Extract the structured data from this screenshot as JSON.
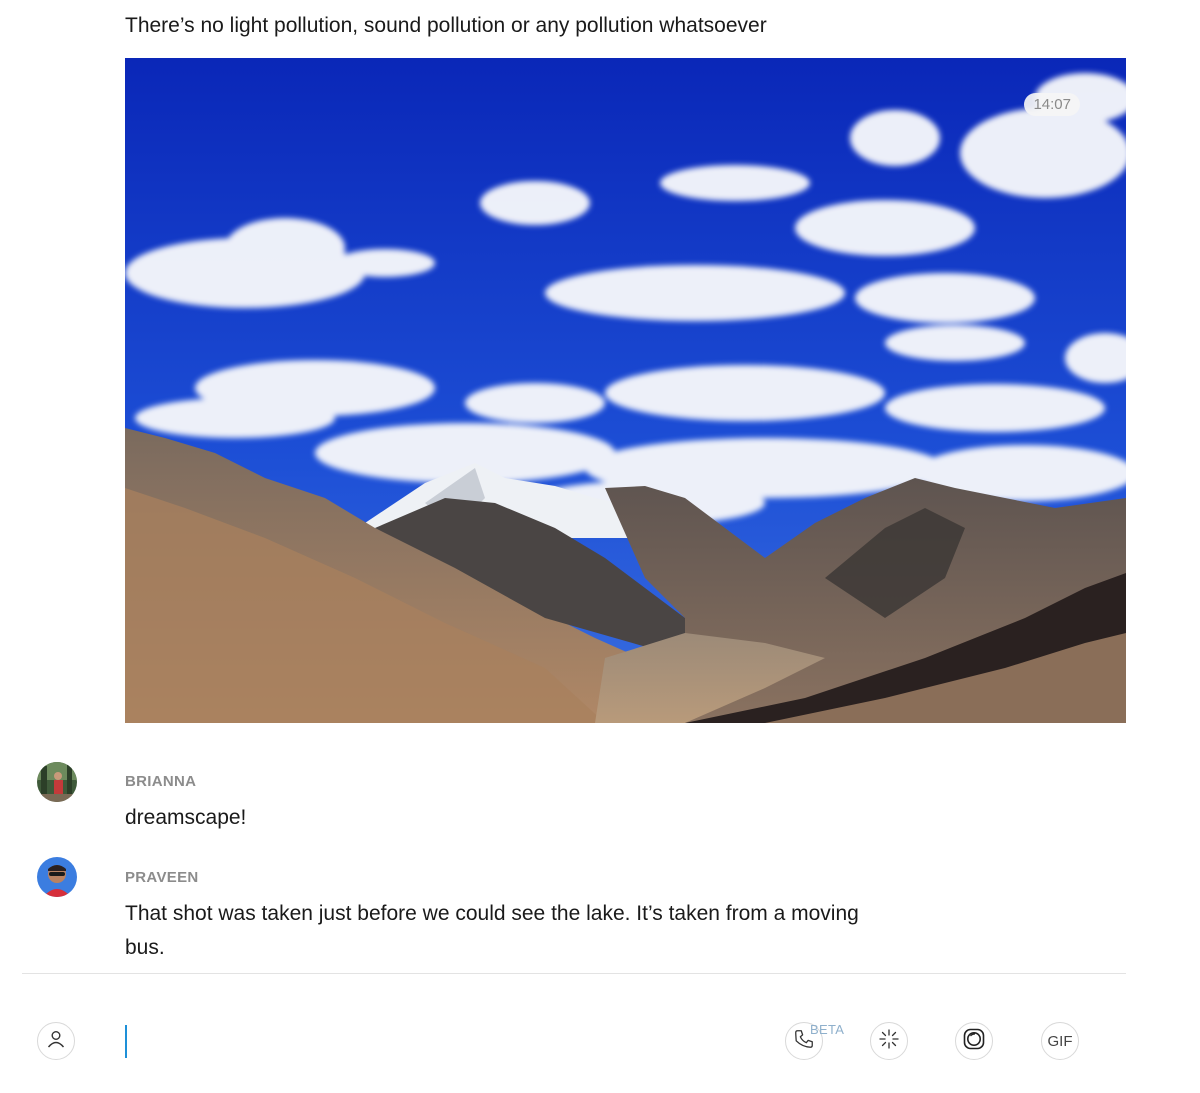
{
  "messages": {
    "intro": {
      "text": "There’s no light pollution, sound pollution or any pollution whatsoever"
    },
    "photo": {
      "timestamp": "14:07"
    },
    "brianna": {
      "sender": "BRIANNA",
      "text": "dreamscape!"
    },
    "praveen": {
      "sender": "PRAVEEN",
      "line1": "That shot was taken just before we could see the lake. It’s taken from a moving",
      "line2": "bus."
    }
  },
  "composer": {
    "input_value": "",
    "call_beta_label": "BETA",
    "gif_label": "GIF"
  },
  "icons": {
    "profile": "user-icon",
    "call": "phone-icon",
    "spark": "spark-icon",
    "camera": "camera-icon",
    "gif": "gif-icon"
  },
  "colors": {
    "accent_caret": "#1e90d8",
    "sender_gray": "#8c8c8c",
    "beta_blue": "#8fb0cc",
    "sky": "#1a3fc4"
  }
}
